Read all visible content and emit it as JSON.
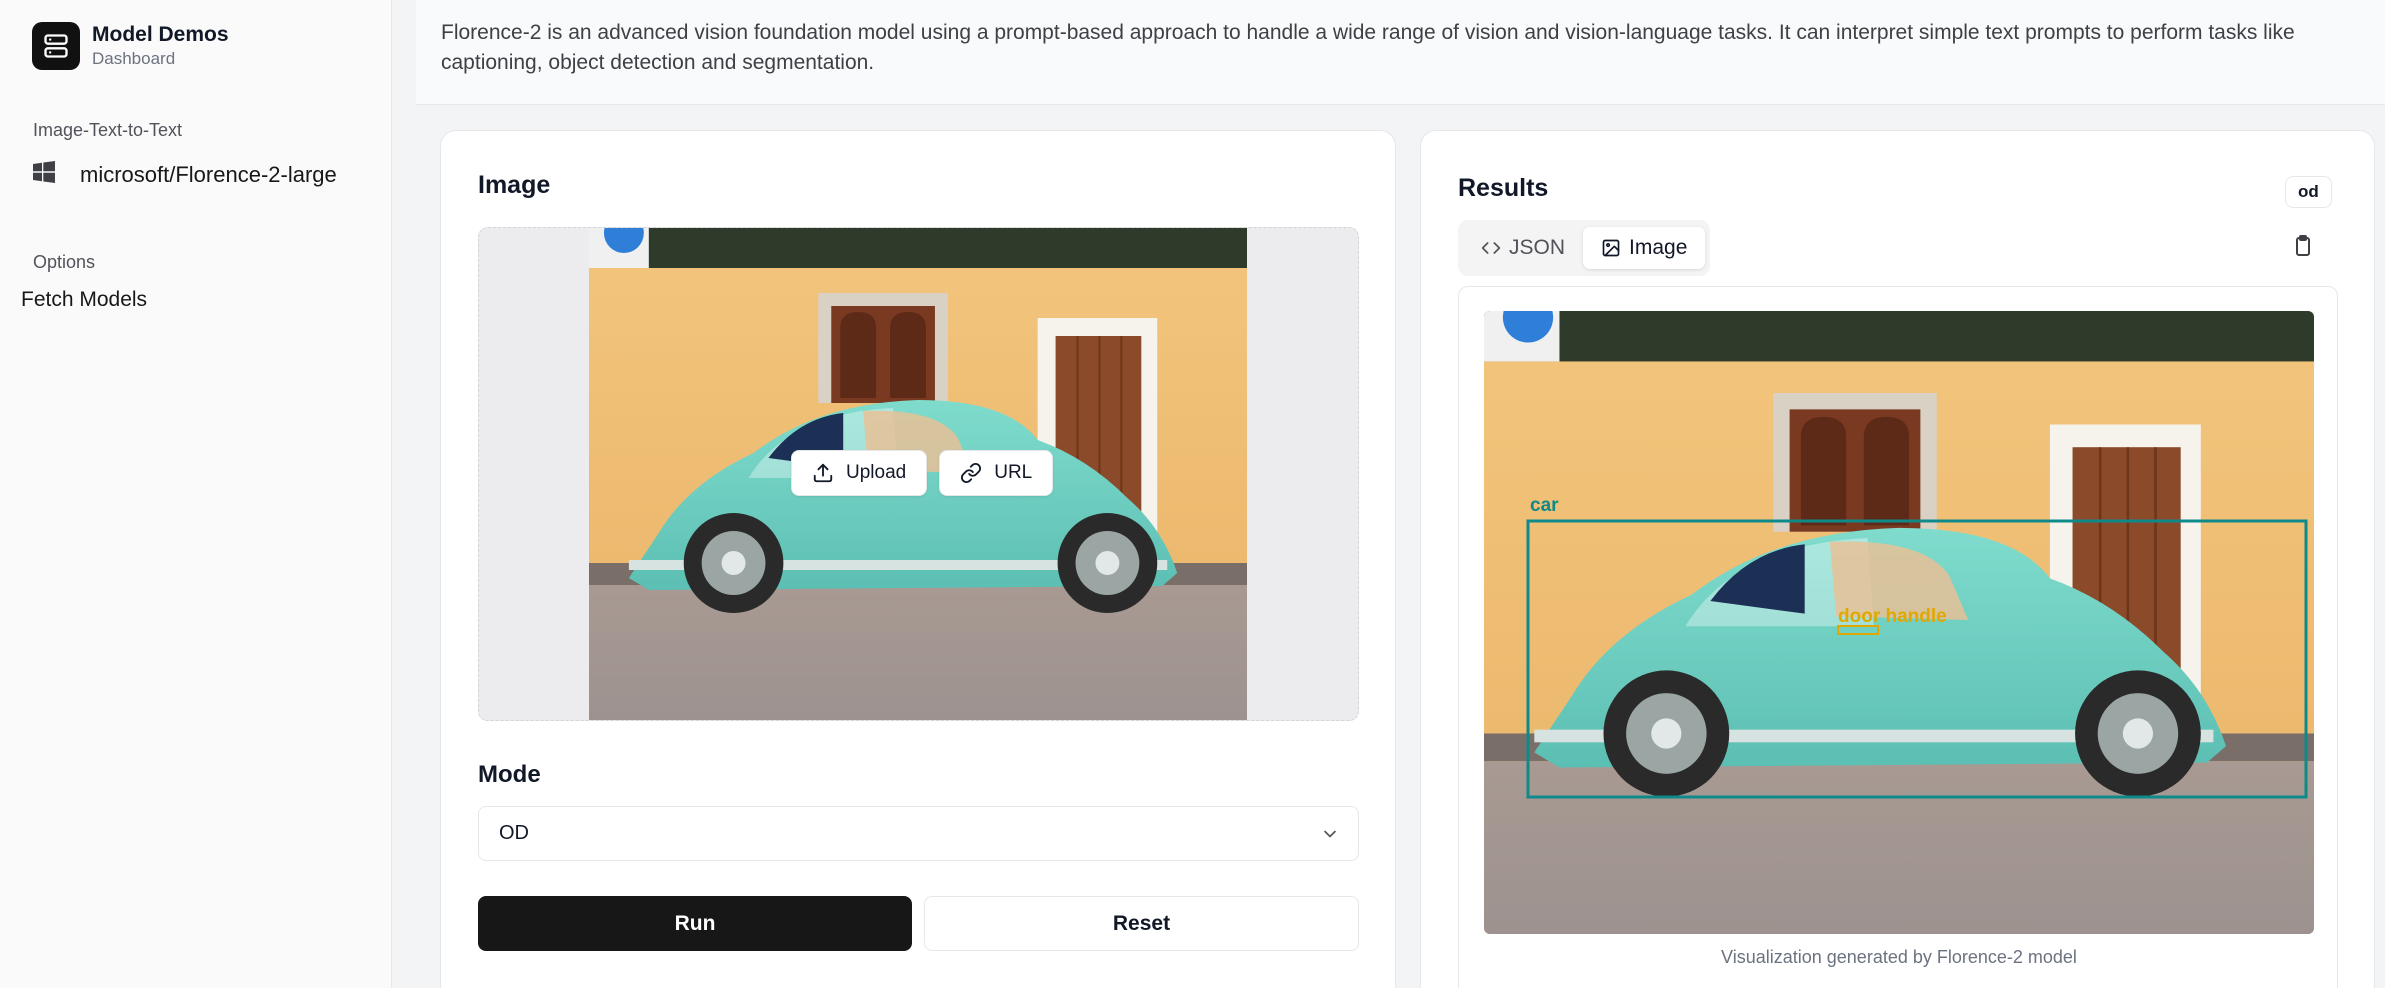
{
  "sidebar": {
    "brand_title": "Model Demos",
    "brand_subtitle": "Dashboard",
    "section_task": "Image-Text-to-Text",
    "model_item": "microsoft/Florence-2-large",
    "section_options": "Options",
    "fetch_models": "Fetch Models"
  },
  "header": {
    "description": "Florence-2 is an advanced vision foundation model using a prompt-based approach to handle a wide range of vision and vision-language tasks. It can interpret simple text prompts to perform tasks like captioning, object detection and segmentation."
  },
  "input_card": {
    "title": "Image",
    "upload_label": "Upload",
    "url_label": "URL",
    "mode_label": "Mode",
    "mode_value": "OD",
    "run_label": "Run",
    "reset_label": "Reset"
  },
  "results_card": {
    "title": "Results",
    "badge": "od",
    "tabs": [
      {
        "label": "JSON",
        "icon": "code-icon",
        "active": false
      },
      {
        "label": "Image",
        "icon": "image-icon",
        "active": true
      }
    ],
    "detections": [
      {
        "label": "car",
        "color": "#0f8a8a"
      },
      {
        "label": "door handle",
        "color": "#e0a800"
      }
    ],
    "caption": "Visualization generated by Florence-2 model"
  },
  "colors": {
    "wall": "#f0bb6a",
    "car": "#6fd0c3",
    "bbox_car": "#0f8a8a",
    "bbox_handle": "#e0a800",
    "run_button": "#171717"
  }
}
